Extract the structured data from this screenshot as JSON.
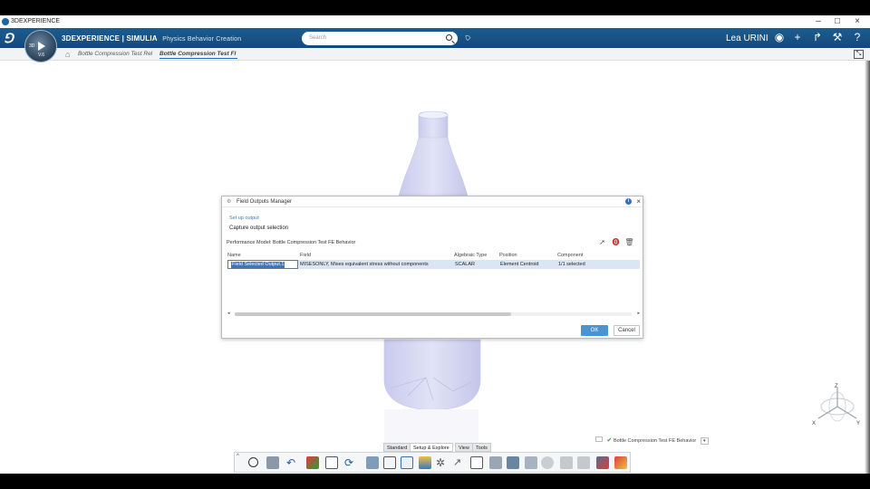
{
  "window": {
    "title": "3DEXPERIENCE",
    "minimize": "–",
    "maximize": "□",
    "close": "×"
  },
  "header": {
    "brand": "3DEXPERIENCE | SIMULIA",
    "app": "Physics Behavior Creation",
    "compass_version": "V.6",
    "compass_3d": "3D",
    "search_placeholder": "Search",
    "user": "Lea URINI"
  },
  "breadcrumb": {
    "items": [
      "Bottle Compression Test Rel",
      "Bottle Compression Test Fl"
    ]
  },
  "dialog": {
    "title": "Field Outputs Manager",
    "link": "Set up output",
    "subtitle": "Capture output selection",
    "performance_model": "Performance Model: Bottle Compression Test FE Behavior",
    "columns": [
      "Name",
      "Field",
      "Algebraic Type",
      "Position",
      "Component"
    ],
    "rows": [
      {
        "name": "Field Selected Output.1",
        "field": "MISESONLY, Mises equivalent stress without components",
        "algebraic_type": "SCALAR",
        "position": "Element Centroid",
        "component": "1/1 selected"
      }
    ],
    "ok": "OK",
    "cancel": "Cancel"
  },
  "triad": {
    "x": "X",
    "y": "Y",
    "z": "Z"
  },
  "toolbar": {
    "tabs": [
      "Standard",
      "Setup & Explore",
      "View",
      "Tools"
    ],
    "active_tab": "Setup & Explore"
  },
  "status": {
    "object": "Bottle Compression Test FE Behavior"
  },
  "colors": {
    "header": "#1c5c91",
    "accent": "#4c93d3",
    "selection": "#dbe6f4"
  }
}
